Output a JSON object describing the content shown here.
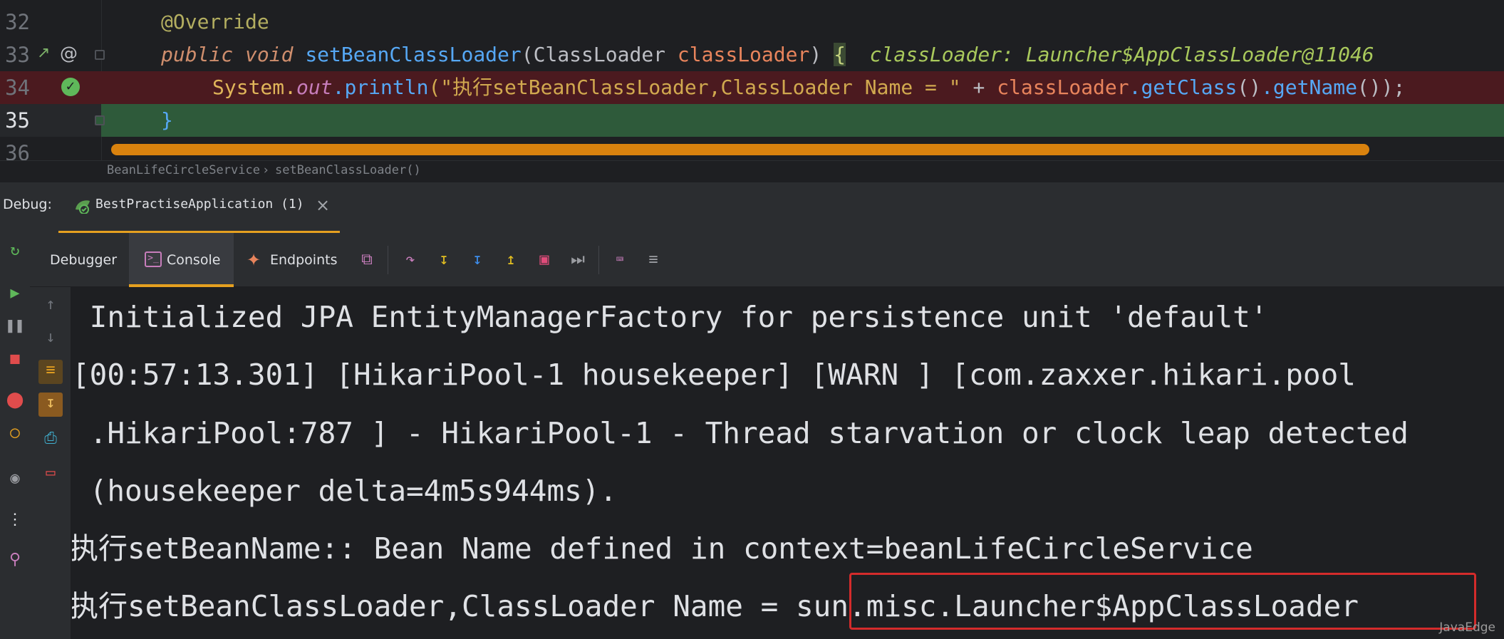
{
  "editor": {
    "lines": [
      {
        "num": "32"
      },
      {
        "num": "33"
      },
      {
        "num": "34"
      },
      {
        "num": "35"
      },
      {
        "num": "36"
      }
    ],
    "l32_annotation": "@Override",
    "l33_public": "public",
    "l33_void": "void",
    "l33_method": "setBeanClassLoader",
    "l33_paren_open": "(",
    "l33_type": "ClassLoader",
    "l33_param": "classLoader",
    "l33_paren_close": ")",
    "l33_brace": "{",
    "l33_hint": "classLoader: Launcher$AppClassLoader@11046",
    "l34_system": "System.",
    "l34_out": "out",
    "l34_println": ".println",
    "l34_string": "(\"执行setBeanClassLoader,ClassLoader Name = \"",
    "l34_plus": " + ",
    "l34_var": "classLoader",
    "l34_getclass": ".getClass",
    "l34_paren1": "()",
    "l34_getname": ".getName",
    "l34_end": "());",
    "l35_brace": "}",
    "breadcrumb": [
      "BeanLifeCircleService",
      "setBeanClassLoader()"
    ],
    "breadcrumb_sep": "›"
  },
  "debug": {
    "label": "Debug:",
    "run_tab_label": "BestPractiseApplication (1)",
    "close_glyph": "×",
    "tabs": {
      "debugger": "Debugger",
      "console": "Console",
      "endpoints": "Endpoints"
    }
  },
  "console": {
    "lines": [
      " Initialized JPA EntityManagerFactory for persistence unit 'default'",
      "[00:57:13.301] [HikariPool-1 housekeeper] [WARN ] [com.zaxxer.hikari.pool",
      " .HikariPool:787 ] - HikariPool-1 - Thread starvation or clock leap detected",
      " (housekeeper delta=4m5s944ms).",
      "执行setBeanName:: Bean Name defined in context=beanLifeCircleService",
      "执行setBeanClassLoader,ClassLoader Name = sun.misc.Launcher$AppClassLoader"
    ]
  },
  "watermark": "JavaEdge",
  "colors": {
    "accent_tab": "#e5a020",
    "highlight_box": "#d42b2b",
    "line34_bg": "#4b1a1f",
    "line35_bg": "#2e5a3a",
    "scrollbar": "#d9820e"
  }
}
